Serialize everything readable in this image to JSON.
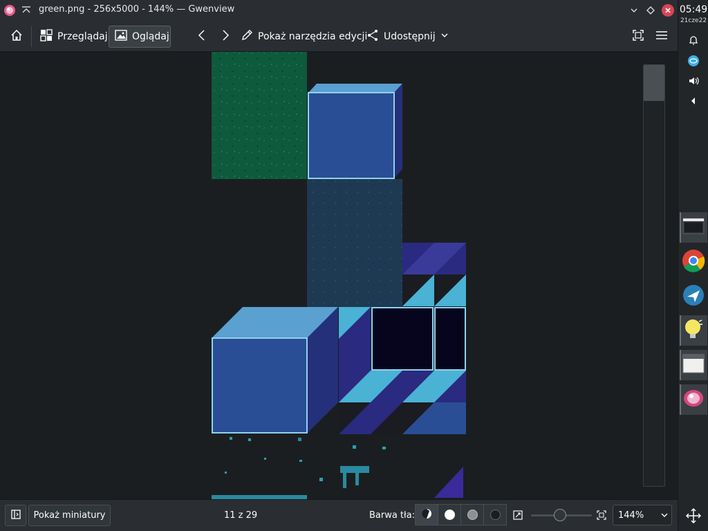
{
  "window": {
    "title": "green.png - 256x5000 - 144% — Gwenview"
  },
  "toolbar": {
    "browse_label": "Przeglądaj",
    "view_label": "Oglądaj",
    "edit_tools_label": "Pokaż narzędzia edycji",
    "share_label": "Udostępnij"
  },
  "statusbar": {
    "thumbnails_label": "Pokaż miniatury",
    "position_text": "11 z 29",
    "background_label": "Barwa tła:",
    "background_options": [
      "auto",
      "white",
      "gray",
      "black"
    ],
    "zoom_value": "144%"
  },
  "panel": {
    "time": "05:49",
    "date": "21cze22"
  },
  "icons": {
    "home": "home-icon",
    "browse": "grid-icon",
    "view": "image-icon",
    "prev": "chevron-left-icon",
    "next": "chevron-right-icon",
    "edit": "pencil-icon",
    "share": "share-icon",
    "fullscreen": "fullscreen-icon",
    "menu": "hamburger-icon"
  },
  "colors": {
    "accent": "#3daee9",
    "close": "#da4453",
    "cube_face": "#2a4e96",
    "cube_top": "#5aa0d0",
    "cube_edge": "#8fd2ee",
    "grass": "#0f5a3c"
  }
}
